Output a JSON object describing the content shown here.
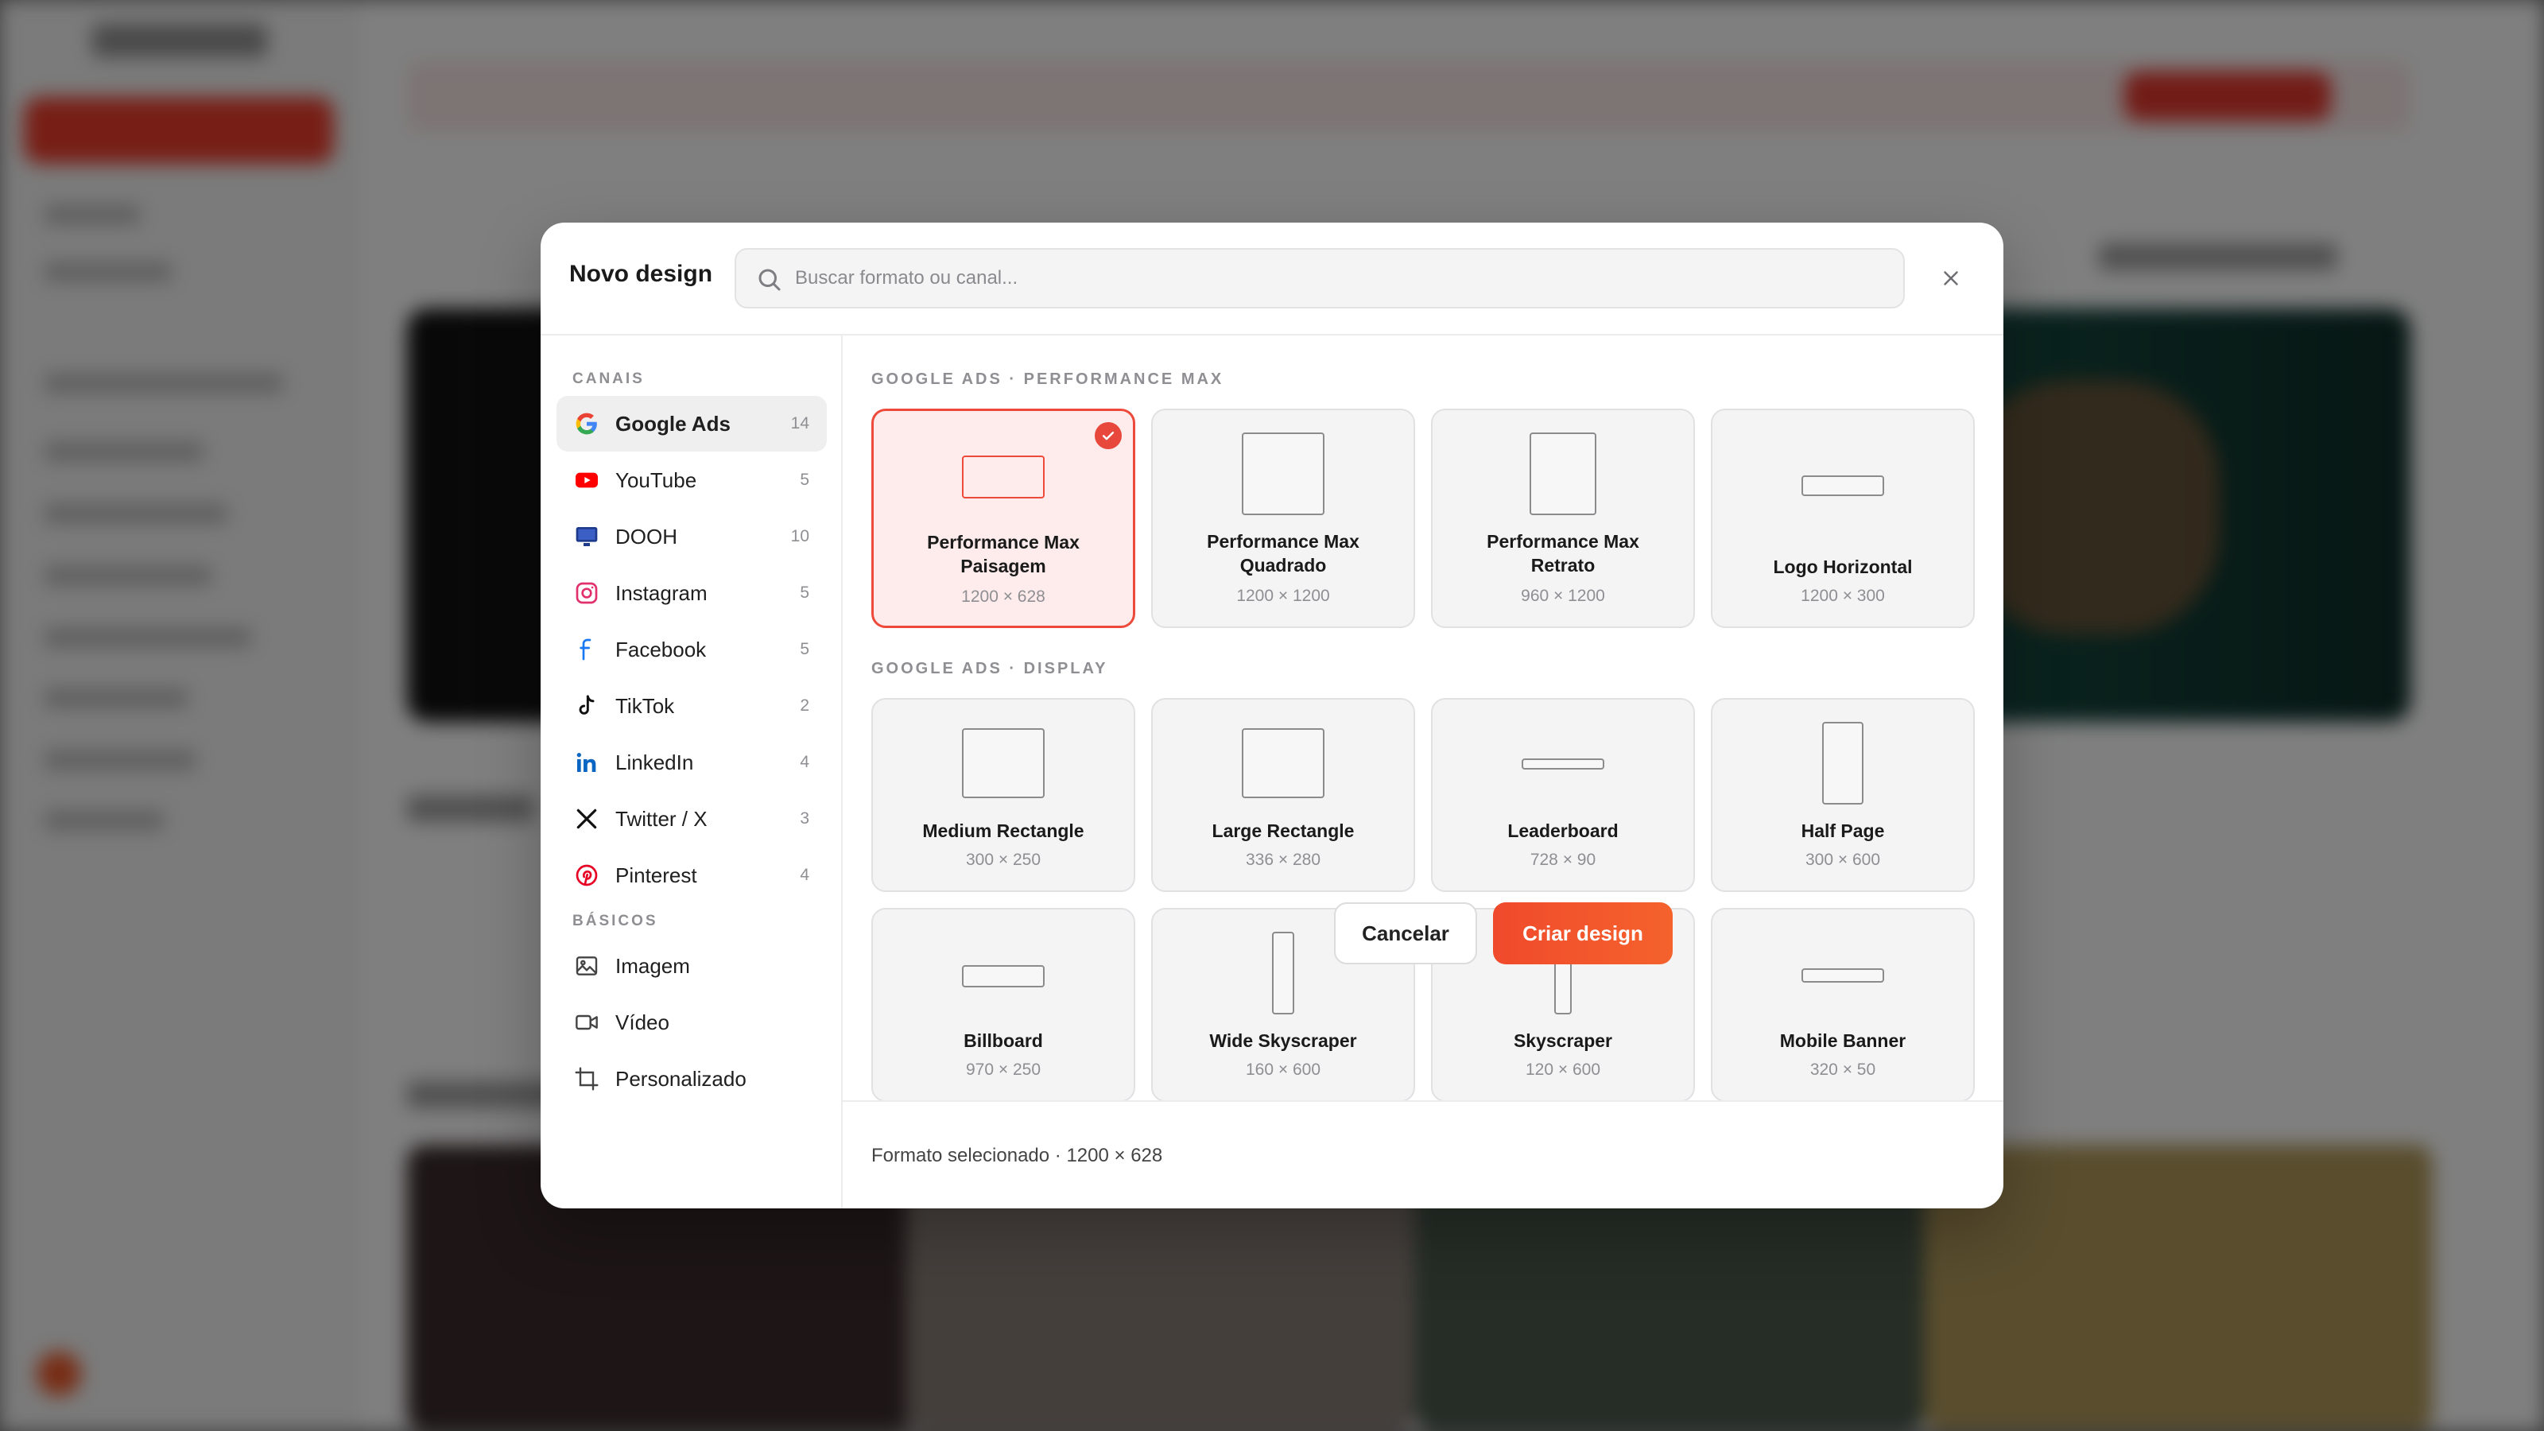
{
  "modal": {
    "title": "Novo design",
    "search": {
      "placeholder": "Buscar formato ou canal..."
    },
    "close_icon": "close-icon"
  },
  "sidebar": {
    "section_channels": "CANAIS",
    "channels": [
      {
        "label": "Google Ads",
        "count": "14",
        "icon": "google-icon",
        "active": true
      },
      {
        "label": "YouTube",
        "count": "5",
        "icon": "youtube-icon"
      },
      {
        "label": "DOOH",
        "count": "10",
        "icon": "monitor-icon"
      },
      {
        "label": "Instagram",
        "count": "5",
        "icon": "instagram-icon"
      },
      {
        "label": "Facebook",
        "count": "5",
        "icon": "facebook-icon"
      },
      {
        "label": "TikTok",
        "count": "2",
        "icon": "tiktok-icon"
      },
      {
        "label": "LinkedIn",
        "count": "4",
        "icon": "linkedin-icon"
      },
      {
        "label": "Twitter / X",
        "count": "3",
        "icon": "x-icon"
      },
      {
        "label": "Pinterest",
        "count": "4",
        "icon": "pinterest-icon"
      }
    ],
    "section_basics": "BÁSICOS",
    "basics": [
      {
        "label": "Imagem",
        "icon": "image-icon"
      },
      {
        "label": "Vídeo",
        "icon": "video-icon"
      },
      {
        "label": "Personalizado",
        "icon": "crop-icon"
      }
    ]
  },
  "content": {
    "groups": [
      {
        "title": "GOOGLE ADS · PERFORMANCE MAX",
        "formats": [
          {
            "name": "Performance Max Paisagem",
            "size": "1200 × 628",
            "selected": true
          },
          {
            "name": "Performance Max Quadrado",
            "size": "1200 × 1200"
          },
          {
            "name": "Performance Max Retrato",
            "size": "960 × 1200"
          },
          {
            "name": "Logo Horizontal",
            "size": "1200 × 300"
          }
        ]
      },
      {
        "title": "GOOGLE ADS · DISPLAY",
        "formats": [
          {
            "name": "Medium Rectangle",
            "size": "300 × 250"
          },
          {
            "name": "Large Rectangle",
            "size": "336 × 280"
          },
          {
            "name": "Leaderboard",
            "size": "728 × 90"
          },
          {
            "name": "Half Page",
            "size": "300 × 600"
          },
          {
            "name": "Billboard",
            "size": "970 × 250"
          },
          {
            "name": "Wide Skyscraper",
            "size": "160 × 600"
          },
          {
            "name": "Skyscraper",
            "size": "120 × 600"
          },
          {
            "name": "Mobile Banner",
            "size": "320 × 50"
          }
        ]
      }
    ]
  },
  "footer": {
    "selected_text": "Formato selecionado · 1200 × 628",
    "cancel_label": "Cancelar",
    "create_label": "Criar design"
  },
  "colors": {
    "accent": "#ee4a3b",
    "create_button": "#f25a2c",
    "selected_card_bg": "#fdeceb"
  }
}
